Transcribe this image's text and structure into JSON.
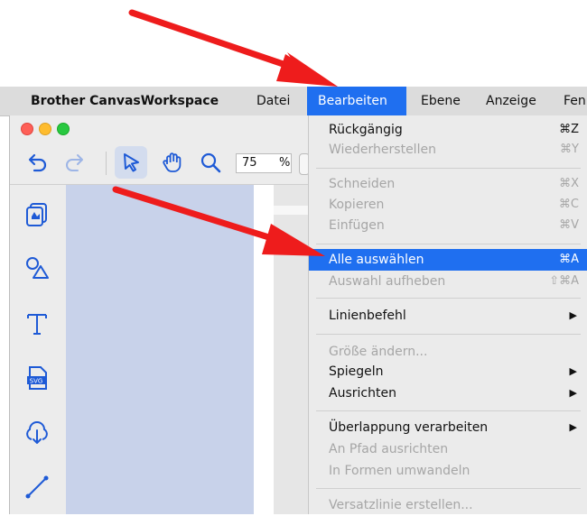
{
  "menubar": {
    "app_name": "Brother CanvasWorkspace",
    "items": [
      "Datei",
      "Bearbeiten",
      "Ebene",
      "Anzeige",
      "Fen"
    ]
  },
  "toolbar": {
    "zoom_value": "75",
    "zoom_unit": "%",
    "icons": [
      "undo-icon",
      "redo-icon",
      "select-arrow-icon",
      "hand-icon",
      "zoom-icon"
    ]
  },
  "sidebar_tools": [
    "pattern-icon",
    "shapes-icon",
    "text-icon",
    "svg-import-icon",
    "tracing-icon",
    "line-icon"
  ],
  "edit_menu": {
    "undo": {
      "label": "Rückgängig",
      "shortcut": "⌘Z"
    },
    "redo": {
      "label": "Wiederherstellen",
      "shortcut": "⌘Y"
    },
    "cut": {
      "label": "Schneiden",
      "shortcut": "⌘X"
    },
    "copy": {
      "label": "Kopieren",
      "shortcut": "⌘C"
    },
    "paste": {
      "label": "Einfügen",
      "shortcut": "⌘V"
    },
    "select_all": {
      "label": "Alle auswählen",
      "shortcut": "⌘A"
    },
    "deselect": {
      "label": "Auswahl aufheben",
      "shortcut": "⇧⌘A"
    },
    "line_command": {
      "label": "Linienbefehl",
      "arrow": "▶"
    },
    "resize": {
      "label": "Größe ändern..."
    },
    "mirror": {
      "label": "Spiegeln",
      "arrow": "▶"
    },
    "align": {
      "label": "Ausrichten",
      "arrow": "▶"
    },
    "overlap": {
      "label": "Überlappung verarbeiten",
      "arrow": "▶"
    },
    "align_to_path": {
      "label": "An Pfad ausrichten"
    },
    "convert_to_shapes": {
      "label": "In Formen umwandeln"
    },
    "offset_line": {
      "label": "Versatzlinie erstellen..."
    }
  },
  "colors": {
    "highlight": "#1f6ff0",
    "annotation_arrow": "#ee1c1c",
    "canvas": "#c8d2ea",
    "toolbar_icon": "#1e5ad6"
  }
}
